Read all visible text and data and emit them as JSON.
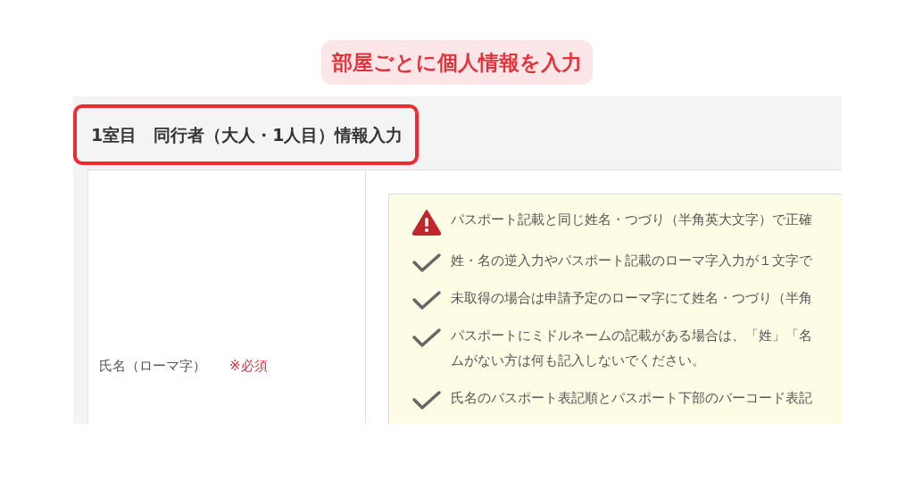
{
  "annotation": {
    "text": "部屋ごとに個人情報を入力"
  },
  "section": {
    "title": "1室目　同行者（大人・1人目）情報入力",
    "highlighted": true
  },
  "field": {
    "label": "氏名（ローマ字）",
    "required_mark": "※必須"
  },
  "notices": [
    {
      "kind": "warning",
      "text": "パスポート記載と同じ姓名・つづり（半角英大文字）で正確"
    },
    {
      "kind": "check",
      "text": "姓・名の逆入力やパスポート記載のローマ字入力が１文字で"
    },
    {
      "kind": "check",
      "text": "未取得の場合は申請予定のローマ字にて姓名・つづり（半角"
    },
    {
      "kind": "check",
      "text": "パスポートにミドルネームの記載がある場合は、「姓」「名ムがない方は何も記入しないでください。"
    },
    {
      "kind": "check",
      "text": "氏名のパスポート表記順とパスポート下部のバーコード表記"
    }
  ]
}
